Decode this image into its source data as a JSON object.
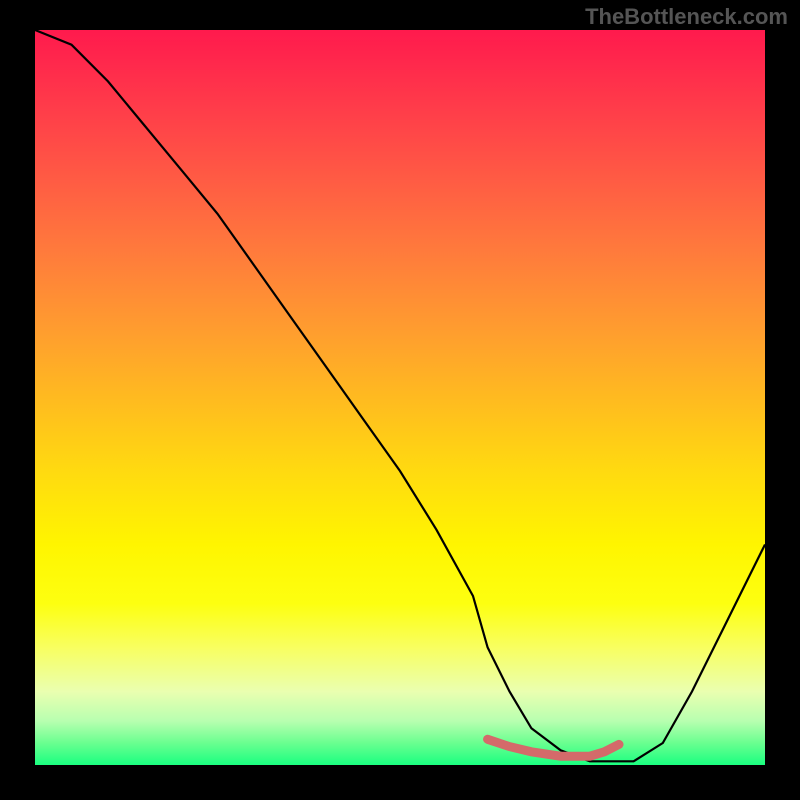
{
  "watermark": "TheBottleneck.com",
  "chart_data": {
    "type": "line",
    "title": "",
    "xlabel": "",
    "ylabel": "",
    "xlim": [
      0,
      100
    ],
    "ylim": [
      0,
      100
    ],
    "series": [
      {
        "name": "bottleneck-curve",
        "x": [
          0,
          5,
          10,
          15,
          20,
          25,
          30,
          35,
          40,
          45,
          50,
          55,
          60,
          62,
          65,
          68,
          72,
          76,
          78,
          82,
          86,
          90,
          94,
          98,
          100
        ],
        "values": [
          100,
          98,
          93,
          87,
          81,
          75,
          68,
          61,
          54,
          47,
          40,
          32,
          23,
          16,
          10,
          5,
          2,
          0.5,
          0.5,
          0.5,
          3,
          10,
          18,
          26,
          30
        ]
      },
      {
        "name": "highlight-segment",
        "color": "#d46a6a",
        "x": [
          62,
          65,
          68,
          72,
          76,
          78,
          80
        ],
        "values": [
          3.5,
          2.5,
          1.8,
          1.2,
          1.2,
          1.8,
          2.8
        ]
      }
    ],
    "gradient": {
      "stops": [
        {
          "pos": 0,
          "color": "#ff1a4d"
        },
        {
          "pos": 50,
          "color": "#ffda10"
        },
        {
          "pos": 100,
          "color": "#1aff80"
        }
      ]
    }
  }
}
